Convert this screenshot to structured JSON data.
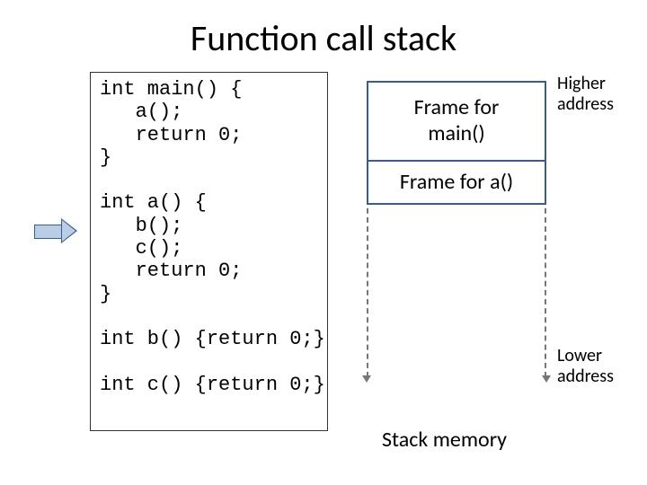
{
  "title": "Function call stack",
  "code": {
    "main": "int main() {\n   a();\n   return 0;\n}",
    "a": "int a() {\n   b();\n   c();\n   return 0;\n}",
    "b": "int b() {return 0;}",
    "c": "int c() {return 0;}"
  },
  "stack": {
    "frames": [
      {
        "id": "main",
        "label": "Frame for\nmain()"
      },
      {
        "id": "a",
        "label": "Frame for a()"
      }
    ],
    "memory_label": "Stack memory",
    "high_label": "Higher\naddress",
    "low_label": "Lower\naddress"
  },
  "current_pointer_target": "a"
}
